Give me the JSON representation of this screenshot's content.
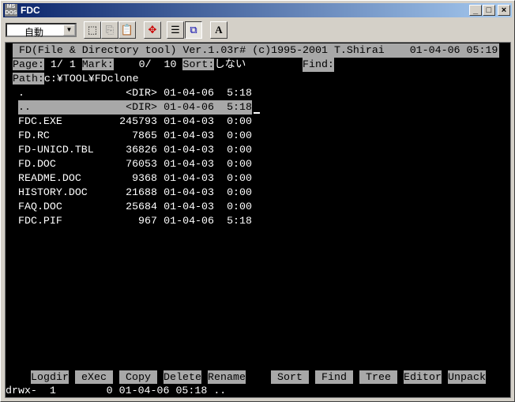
{
  "window": {
    "title": "FDC",
    "app_icon": "ms-dos-icon",
    "buttons": [
      "minimize",
      "maximize",
      "close"
    ]
  },
  "toolbar": {
    "font_combo": "自動",
    "buttons": [
      "mark-icon",
      "copy-icon",
      "paste-icon",
      "fullscreen-icon",
      "properties-icon",
      "background-icon",
      "font-icon"
    ],
    "font_label": "A"
  },
  "terminal": {
    "header": " FD(File & Directory tool) Ver.1.03r# (c)1995-2001 T.Shirai    01-04-06 05:19",
    "page_label": "Page:",
    "page_value": " 1/ 1 ",
    "mark_label": "Mark:",
    "mark_value": "    0/  10 ",
    "sort_label": "Sort:",
    "sort_value": "しない",
    "find_label": "Find:",
    "path_label": "Path:",
    "path_value": "c:¥TOOL¥FDclone",
    "files": [
      {
        "name": ".",
        "size": "<DIR>",
        "date": "01-04-06",
        "time": "5:18"
      },
      {
        "name": "..",
        "size": "<DIR>",
        "date": "01-04-06",
        "time": "5:18",
        "selected": true
      },
      {
        "name": "FDC.EXE",
        "size": "245793",
        "date": "01-04-03",
        "time": "0:00"
      },
      {
        "name": "FD.RC",
        "size": "7865",
        "date": "01-04-03",
        "time": "0:00"
      },
      {
        "name": "FD-UNICD.TBL",
        "size": "36826",
        "date": "01-04-03",
        "time": "0:00"
      },
      {
        "name": "FD.DOC",
        "size": "76053",
        "date": "01-04-03",
        "time": "0:00"
      },
      {
        "name": "README.DOC",
        "size": "9368",
        "date": "01-04-03",
        "time": "0:00"
      },
      {
        "name": "HISTORY.DOC",
        "size": "21688",
        "date": "01-04-03",
        "time": "0:00"
      },
      {
        "name": "FAQ.DOC",
        "size": "25684",
        "date": "01-04-03",
        "time": "0:00"
      },
      {
        "name": "FDC.PIF",
        "size": "967",
        "date": "01-04-06",
        "time": "5:18"
      }
    ],
    "function_keys": [
      "Logdir",
      "eXec",
      "Copy",
      "Delete",
      "Rename",
      "Sort",
      "Find",
      "Tree",
      "Editor",
      "Unpack"
    ],
    "status": "drwx-  1        0 01-04-06 05:18 .."
  }
}
